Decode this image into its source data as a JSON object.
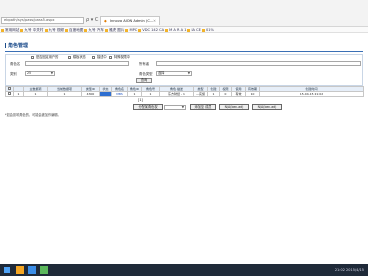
{
  "browser": {
    "address": "ebpath/sys/pass/pass5.aspx",
    "nav_glyphs": "ρ ▾ C ✕",
    "tab_title": "Innova AION Admin (C...",
    "favorites": [
      "常用网站",
      "九号 中关村",
      "九号 视频",
      "百度地图",
      "九号 汽车",
      "雅虎 图片",
      "MPC",
      "VDC 142 CA",
      "M A R A 1",
      "IA CE",
      "01%"
    ]
  },
  "page": {
    "title": "角色管理"
  },
  "form": {
    "role_name_label": "角色名",
    "checkbox_1": "是否固定用户的",
    "checkbox_2": "模板状态",
    "checkbox_3": "描述中",
    "checkbox_4": "特殊权限中",
    "owner_label": "所有者",
    "owner_value": "",
    "category_label": "类别",
    "category_value": "25",
    "role_type_label": "角色类型",
    "role_type_value": "选择",
    "search_button": "查询"
  },
  "table": {
    "headers": [
      "",
      "",
      "主数据项",
      "当前数据项",
      "类型ID",
      "状态",
      "角色名",
      "角色ID",
      "角色号",
      "角色·描述",
      "类型",
      "创建",
      "权限",
      "使用",
      "有效期",
      "创建时间"
    ],
    "rows": [
      [
        "",
        "1",
        "1",
        "1",
        "4300",
        "",
        "MBS",
        "1",
        "1",
        "东方财经 - 1",
        "—实施",
        "1",
        "0",
        "有效",
        "10",
        "15-04-15 21:02"
      ]
    ],
    "row_highlight_color": "#2e6fd1"
  },
  "pager": {
    "text": "[1]"
  },
  "actions": {
    "perm_button": "分配某角色权",
    "perm_select": "",
    "assign_button": "添加至 成员",
    "btn_a": "N/A(bec.ad)",
    "btn_b": "N/A(bec.ad)"
  },
  "note": "*如会影响角色的，可能会被加作编辑。",
  "taskbar": {
    "time": "21:02",
    "date": "2015/4/15"
  }
}
